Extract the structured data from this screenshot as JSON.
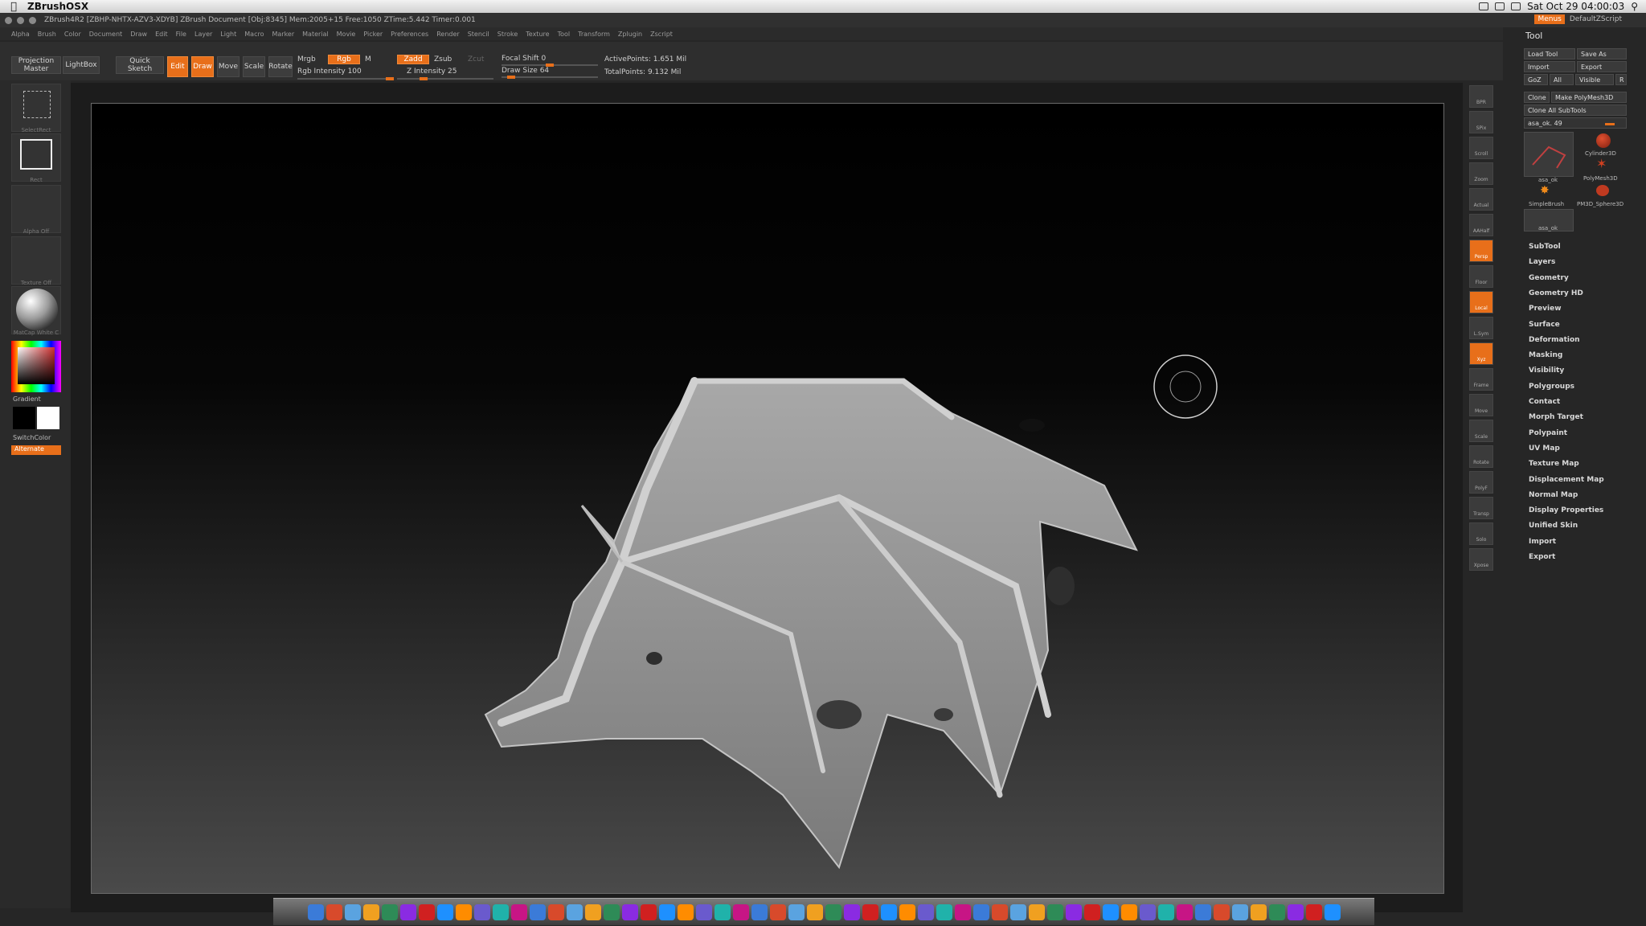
{
  "macbar": {
    "app_name": "ZBrushOSX",
    "clock": "Sat Oct 29  04:00:03"
  },
  "titlebar": {
    "text": "ZBrush4R2 [ZBHP-NHTX-AZV3-XDYB]   ZBrush Document   [Obj:8345] Mem:2005+15 Free:1050 ZTime:5.442 Timer:0.001",
    "menus_label": "Menus",
    "script_label": "DefaultZScript"
  },
  "menus": [
    "Alpha",
    "Brush",
    "Color",
    "Document",
    "Draw",
    "Edit",
    "File",
    "Layer",
    "Light",
    "Macro",
    "Marker",
    "Material",
    "Movie",
    "Picker",
    "Preferences",
    "Render",
    "Stencil",
    "Stroke",
    "Texture",
    "Tool",
    "Transform",
    "Zplugin",
    "Zscript"
  ],
  "shelf": {
    "projection_master": "Projection Master",
    "lightbox": "LightBox",
    "quick_sketch": "Quick Sketch",
    "edit": "Edit",
    "draw": "Draw",
    "move": "Move",
    "scale": "Scale",
    "rotate": "Rotate",
    "mrgb": "Mrgb",
    "rgb": "Rgb",
    "m": "M",
    "zadd": "Zadd",
    "zsub": "Zsub",
    "zcut": "Zcut",
    "rgb_intensity": "Rgb  Intensity 100",
    "z_intensity": "Z Intensity 25",
    "focal_shift": "Focal Shift 0",
    "draw_size": "Draw Size 64",
    "active_points": "ActivePoints: 1.651  Mil",
    "total_points": "TotalPoints: 9.132  Mil",
    "rgb_intensity_value": 100,
    "z_intensity_value": 25,
    "focal_shift_value": 0,
    "draw_size_value": 64
  },
  "left_tray": {
    "select_rect": "SelectRect",
    "rect": "Rect",
    "alpha_off": "Alpha Off",
    "texture_off": "Texture Off",
    "matcap": "MatCap White C",
    "gradient": "Gradient",
    "switch_color": "SwitchColor",
    "alternate": "Alternate"
  },
  "view_tray": [
    "BPR",
    "SPix",
    "Scroll",
    "Zoom",
    "Actual",
    "AAHalf",
    "Persp",
    "Floor",
    "Local",
    "L.Sym",
    "Xyz",
    "Frame",
    "Move",
    "Scale",
    "Rotate",
    "PolyF",
    "Transp",
    "Solo",
    "Xpose"
  ],
  "tool_panel": {
    "title": "Tool",
    "load_tool": "Load Tool",
    "save_as": "Save As",
    "import": "Import",
    "export": "Export",
    "goz": "GoZ",
    "all": "All",
    "visible": "Visible",
    "r": "R",
    "clone": "Clone",
    "make_polymesh": "Make PolyMesh3D",
    "clone_all": "Clone All SubTools",
    "current_tool": "asa_ok. 49",
    "thumbs": {
      "t1": "asa_ok",
      "t2": "Cylinder3D",
      "t3": "PolyMesh3D",
      "t4": "SimpleBrush",
      "t5": "PM3D_Sphere3D",
      "t6": "asa_ok"
    },
    "sections": [
      "SubTool",
      "Layers",
      "Geometry",
      "Geometry HD",
      "Preview",
      "Surface",
      "Deformation",
      "Masking",
      "Visibility",
      "Polygroups",
      "Contact",
      "Morph Target",
      "Polypaint",
      "UV Map",
      "Texture Map",
      "Displacement Map",
      "Normal Map",
      "Display Properties",
      "Unified Skin",
      "Import",
      "Export"
    ]
  },
  "dock_icon_count": 56
}
